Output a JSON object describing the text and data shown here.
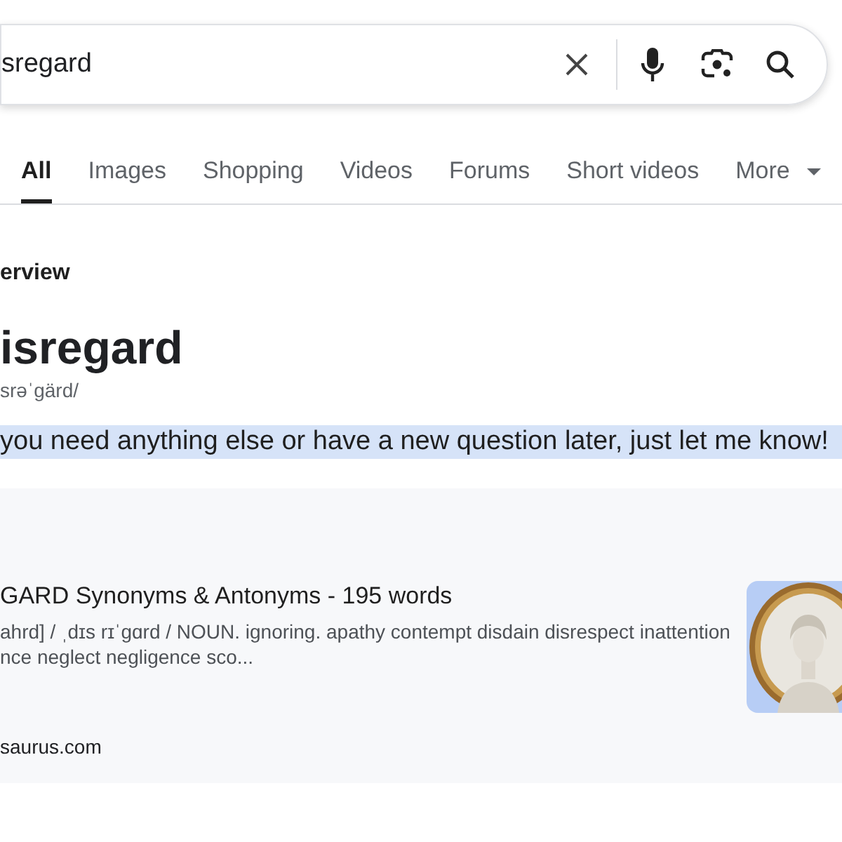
{
  "search": {
    "value": "sregard"
  },
  "tabs": [
    {
      "label": "All",
      "selected": true
    },
    {
      "label": "Images",
      "selected": false
    },
    {
      "label": "Shopping",
      "selected": false
    },
    {
      "label": "Videos",
      "selected": false
    },
    {
      "label": "Forums",
      "selected": false
    },
    {
      "label": "Short videos",
      "selected": false
    },
    {
      "label": "More",
      "selected": false,
      "dropdown": true
    }
  ],
  "overview": {
    "label": "erview",
    "word": "isregard",
    "pronunciation": "srəˈgärd/",
    "highlighted_text": "you need anything else or have a new question later, just let me know!"
  },
  "result": {
    "title": "GARD Synonyms & Antonyms - 195 words",
    "snippet_lines": [
      "ahrd] / ˌdɪs rɪˈgɑrd / NOUN. ignoring. apathy contempt disdain disrespect inattention",
      "nce neglect negligence sco..."
    ],
    "site": "saurus.com"
  }
}
